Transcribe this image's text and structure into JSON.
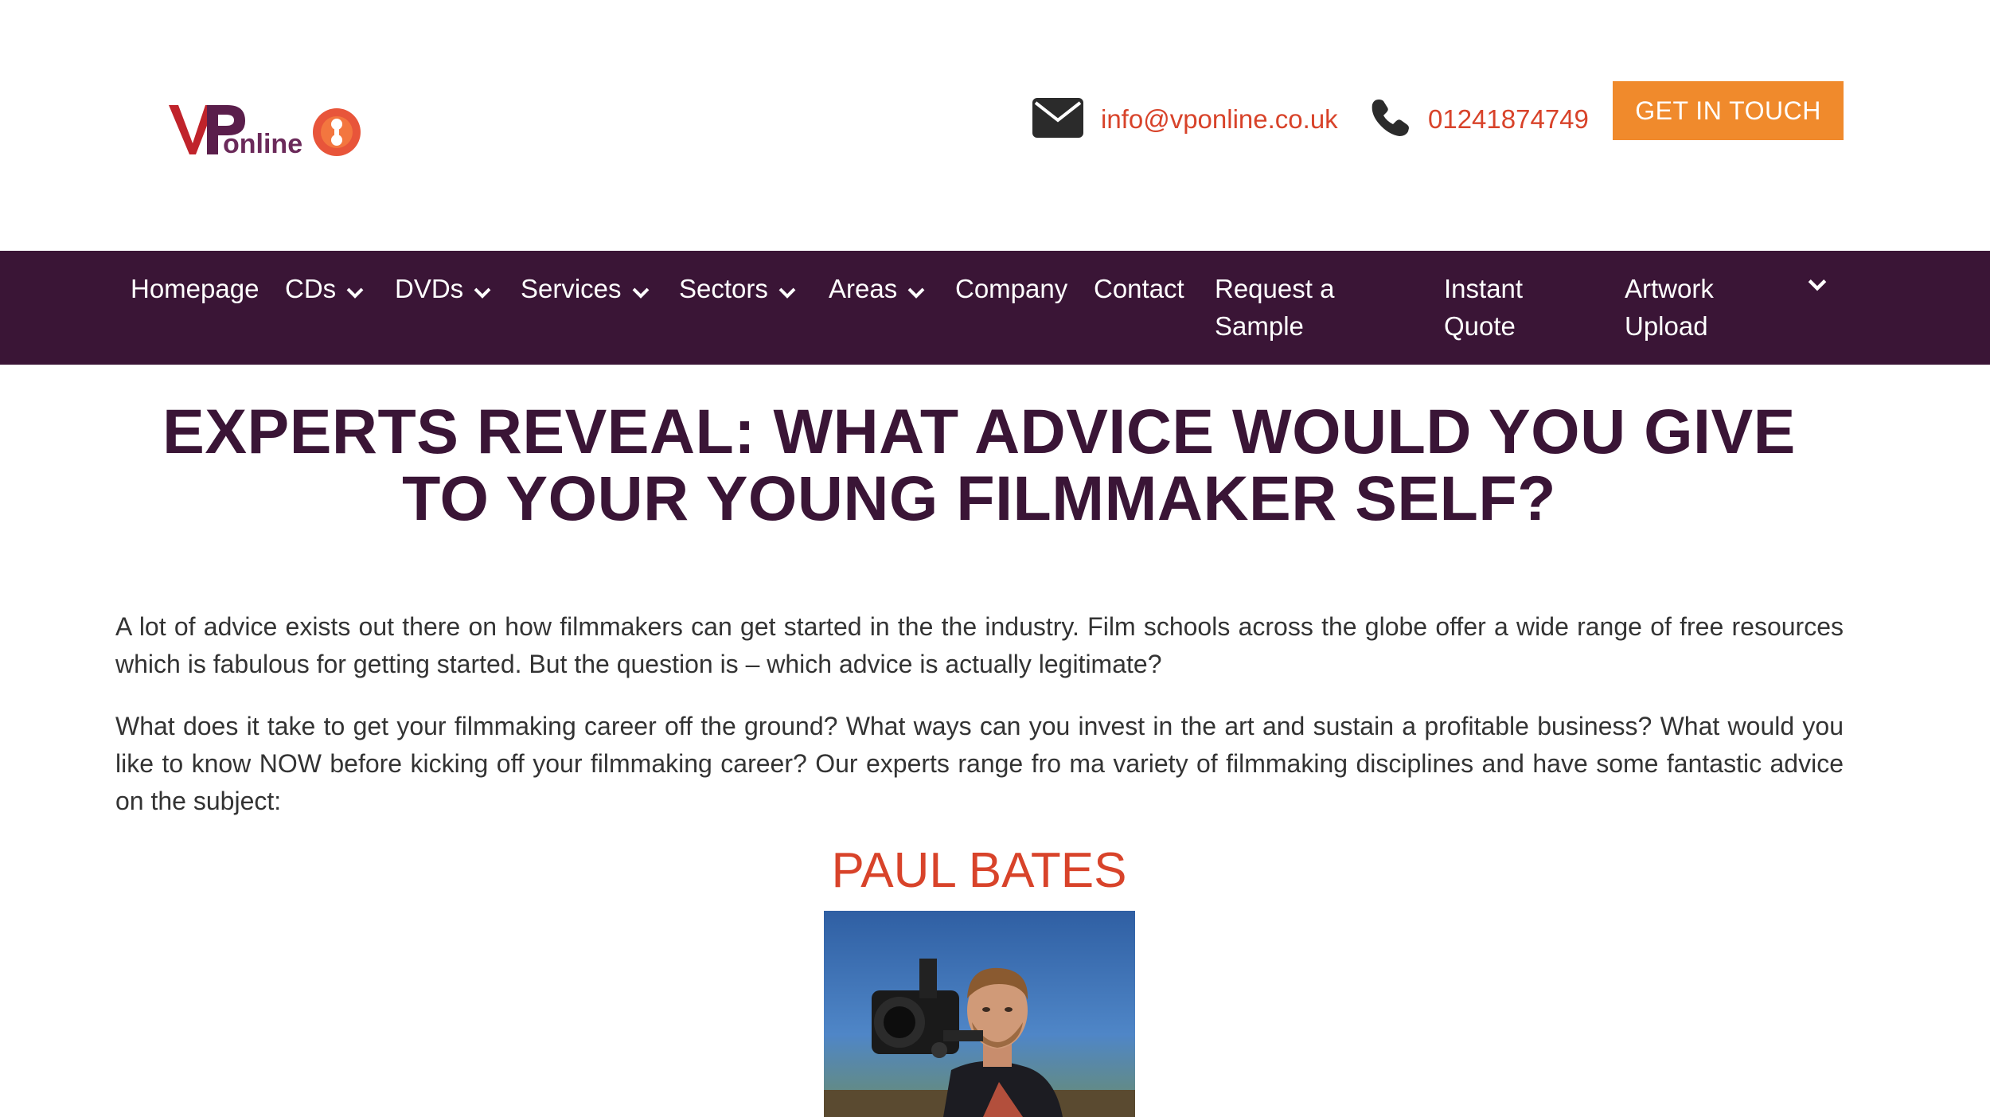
{
  "header": {
    "logo_text": "VPonline",
    "email": "info@vponline.co.uk",
    "phone": "01241874749",
    "cta_label": "GET IN TOUCH"
  },
  "nav": {
    "items": [
      {
        "label": "Homepage",
        "has_dropdown": false
      },
      {
        "label": "CDs",
        "has_dropdown": true
      },
      {
        "label": "DVDs",
        "has_dropdown": true
      },
      {
        "label": "Services",
        "has_dropdown": true
      },
      {
        "label": "Sectors",
        "has_dropdown": true
      },
      {
        "label": "Areas",
        "has_dropdown": true
      },
      {
        "label": "Company",
        "has_dropdown": false
      },
      {
        "label": "Contact",
        "has_dropdown": false
      },
      {
        "label": "Request a Sample",
        "has_dropdown": false
      },
      {
        "label": "Instant Quote",
        "has_dropdown": false
      },
      {
        "label": "Artwork Upload",
        "has_dropdown": false
      }
    ]
  },
  "article": {
    "title": "EXPERTS REVEAL: WHAT ADVICE WOULD YOU GIVE TO YOUR YOUNG FILMMAKER SELF?",
    "paragraphs": [
      "A lot of advice exists out there on how filmmakers can get started in the the industry. Film schools across the globe offer a wide range of free resources which is fabulous for getting started. But the question is – which advice is actually legitimate?",
      "What does it take to get your filmmaking career off the ground? What ways can you invest in the art and sustain a profitable business? What would you like to know NOW before kicking off your filmmaking career? Our experts range fro ma variety of filmmaking disciplines and have some fantastic advice on the subject:"
    ],
    "expert_name": "PAUL BATES"
  },
  "colors": {
    "nav_bg": "#3a1536",
    "title": "#3a1536",
    "accent_red": "#d8432a",
    "cta_orange": "#f08a2c",
    "body_text": "#333333"
  },
  "icons": {
    "email": "envelope-icon",
    "phone": "phone-icon",
    "dropdown": "chevron-down-icon"
  }
}
